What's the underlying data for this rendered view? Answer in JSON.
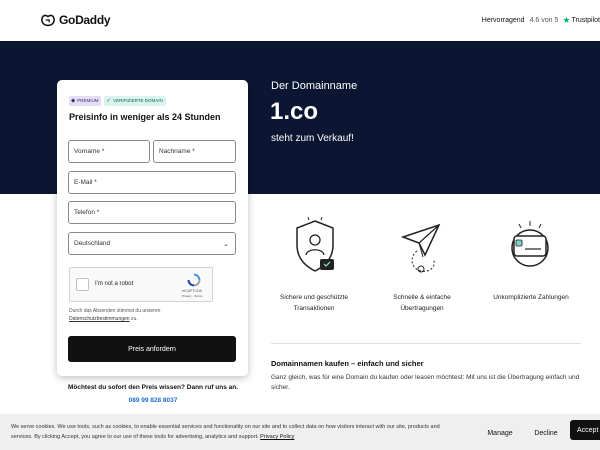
{
  "header": {
    "logo_text": "GoDaddy",
    "rating_label": "Hervorragend",
    "rating_score": "4.6 von 5",
    "trustpilot": "Trustpilot"
  },
  "hero": {
    "subtitle": "Der Domainname",
    "domain": "1.co",
    "sale_text": "steht zum Verkauf!",
    "background_color": "#0b1633"
  },
  "form": {
    "badge_premium": "PREMIUM",
    "badge_verified": "VERIFIZIERTE DOMAIN",
    "title": "Preisinfo in weniger als 24 Stunden",
    "first_name_placeholder": "Vorname *",
    "last_name_placeholder": "Nachname *",
    "email_placeholder": "E-Mail *",
    "phone_placeholder": "Telefon *",
    "country_value": "Deutschland",
    "captcha_label": "I'm not a robot",
    "captcha_brand": "reCAPTCHA",
    "captcha_links": "Privacy - Terms",
    "consent_prefix": "Durch das Absenden stimmst du unseren",
    "consent_link": "Datenschutzbestimmungen",
    "consent_suffix": "zu.",
    "submit_label": "Preis anfordern",
    "call_text": "Möchtest du sofort den Preis wissen? Dann ruf uns an.",
    "phone_number": "089 99 828 8037"
  },
  "features": [
    {
      "icon": "shield-user-icon",
      "label": "Sichere und geschützte Transaktionen"
    },
    {
      "icon": "paper-plane-icon",
      "label": "Schnelle & einfache Übertragungen"
    },
    {
      "icon": "credit-card-icon",
      "label": "Unkomplizierte Zahlungen"
    }
  ],
  "info": {
    "title": "Domainnamen kaufen – einfach und sicher",
    "body": "Ganz gleich, was für eine Domain du kaufen oder leasen möchtest: Mit uns ist die Übertragung einfach und sicher."
  },
  "cookie": {
    "text": "We serve cookies. We use tools, such as cookies, to enable essential services and functionality on our site and to collect data on how visitors interact with our site, products and services. By clicking Accept, you agree to our use of these tools for advertising, analytics and support.",
    "policy_link": "Privacy Policy",
    "manage_label": "Manage",
    "decline_label": "Decline",
    "accept_label": "Accept"
  },
  "colors": {
    "accent": "#111111",
    "link": "#1e6bd6",
    "trustpilot_green": "#00b67a"
  }
}
